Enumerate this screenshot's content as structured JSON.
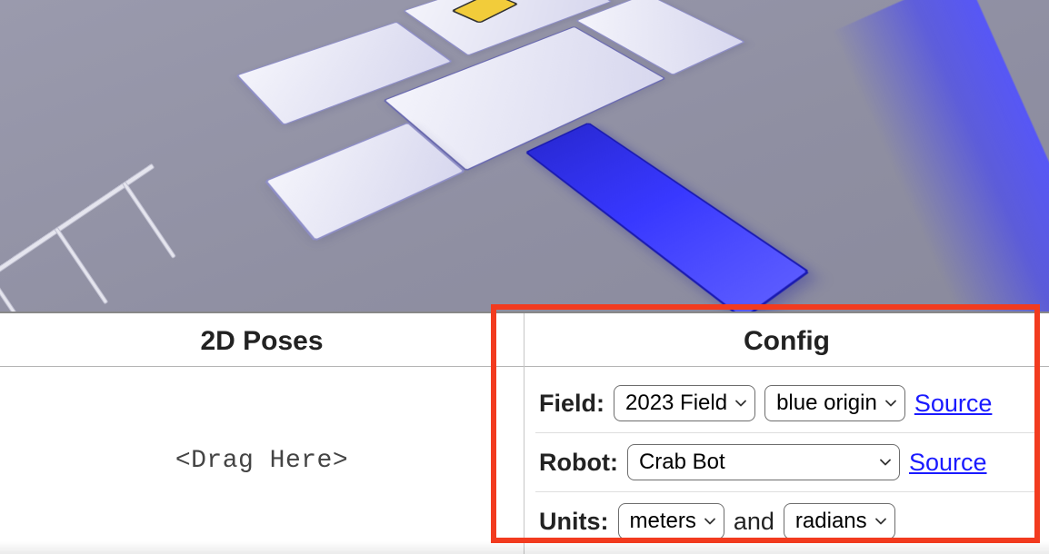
{
  "panels": {
    "poses_title": "2D Poses",
    "drag_placeholder": "<Drag Here>",
    "config_title": "Config"
  },
  "config": {
    "field": {
      "label": "Field:",
      "selected": "2023 Field",
      "origin_selected": "blue origin",
      "source_label": "Source"
    },
    "robot": {
      "label": "Robot:",
      "selected": "Crab Bot",
      "source_label": "Source"
    },
    "units": {
      "label": "Units:",
      "distance_selected": "meters",
      "and": "and",
      "angle_selected": "radians"
    }
  },
  "colors": {
    "highlight": "#f23b1f",
    "link": "#1a1aff",
    "charge_station": "#3838ff"
  }
}
